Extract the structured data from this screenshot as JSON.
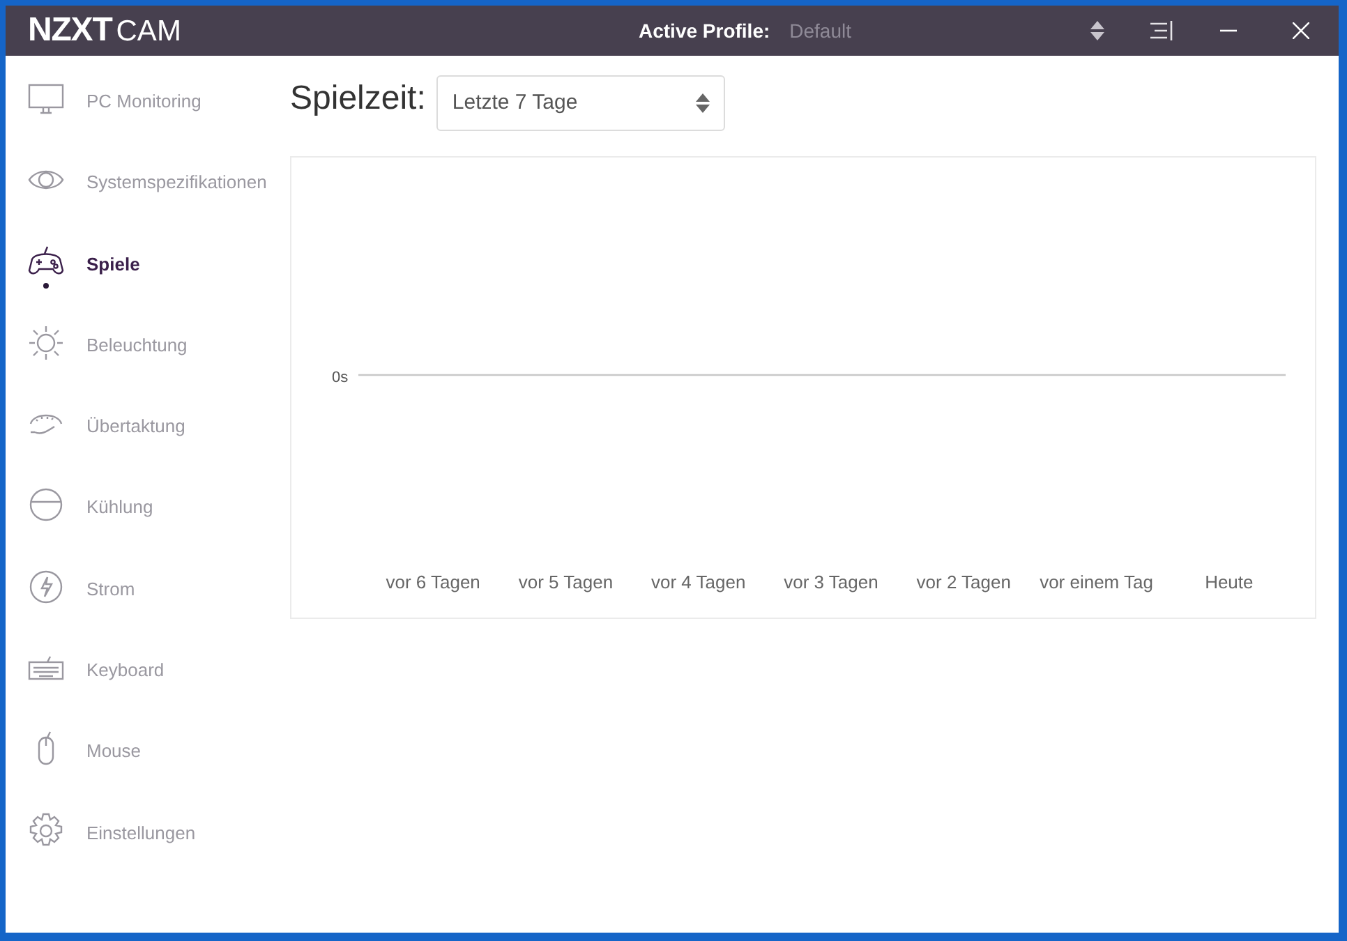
{
  "title_bar": {
    "logo_bold": "NZXT",
    "logo_light": "CAM",
    "profile_label": "Active Profile:",
    "profile_value": "Default"
  },
  "sidebar": {
    "items": [
      {
        "label": "PC Monitoring",
        "selected": false
      },
      {
        "label": "Systemspezifikationen",
        "selected": false
      },
      {
        "label": "Spiele",
        "selected": true
      },
      {
        "label": "Beleuchtung",
        "selected": false
      },
      {
        "label": "Übertaktung",
        "selected": false
      },
      {
        "label": "Kühlung",
        "selected": false
      },
      {
        "label": "Strom",
        "selected": false
      },
      {
        "label": "Keyboard",
        "selected": false
      },
      {
        "label": "Mouse",
        "selected": false
      },
      {
        "label": "Einstellungen",
        "selected": false
      }
    ]
  },
  "header": {
    "label": "Spielzeit:",
    "range_select": {
      "value": "Letzte 7 Tage"
    }
  },
  "chart": {
    "y_axis_label": "0s",
    "x_axis_labels": [
      "vor 6 Tagen",
      "vor 5 Tagen",
      "vor 4 Tagen",
      "vor 3 Tagen",
      "vor 2 Tagen",
      "vor einem Tag",
      "Heute"
    ]
  }
}
